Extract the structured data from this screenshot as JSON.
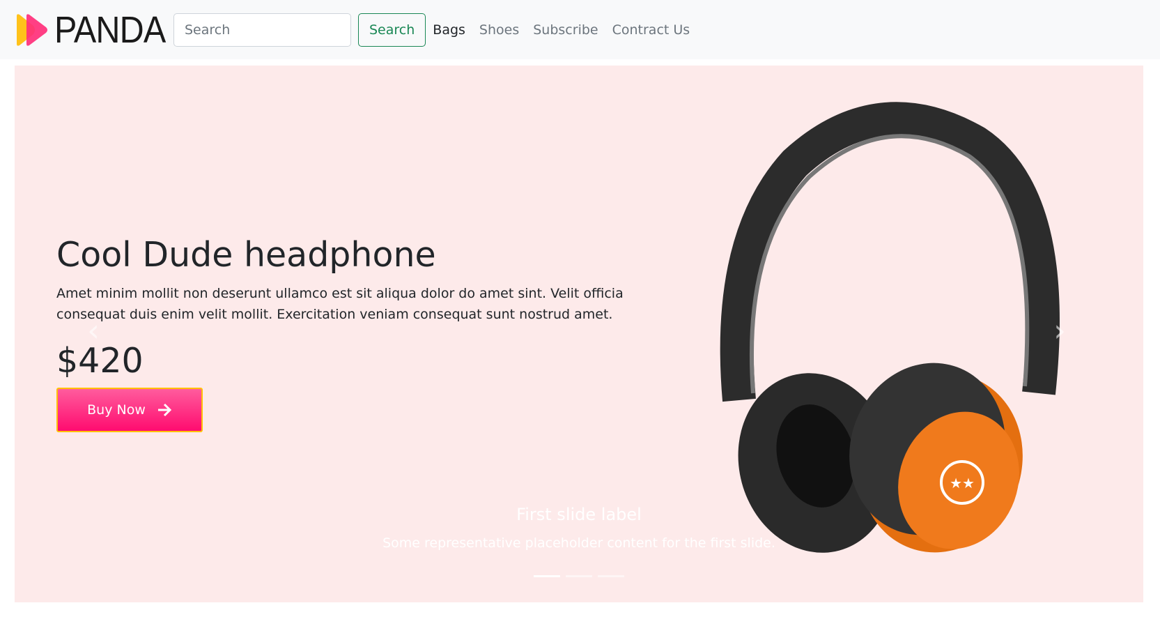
{
  "brand": {
    "name": "PANDA",
    "logo_colors": [
      "#ffc21a",
      "#ff2f7a"
    ]
  },
  "search": {
    "placeholder": "Search",
    "button_label": "Search"
  },
  "nav": {
    "links": [
      {
        "label": "Bags",
        "active": true
      },
      {
        "label": "Shoes"
      },
      {
        "label": "Subscribe"
      },
      {
        "label": "Contract Us"
      }
    ]
  },
  "hero": {
    "title": "Cool Dude headphone",
    "description": "Amet minim mollit non deserunt ullamco est sit aliqua dolor do amet sint. Velit officia consequat duis enim velit mollit. Exercitation veniam consequat sunt nostrud amet.",
    "price": "$420",
    "buy_label": "Buy Now",
    "buy_icon": "arrow-right-icon",
    "accent": "#ff1a75",
    "background": "#fdeaea"
  },
  "carousel": {
    "caption_title": "First slide label",
    "caption_text": "Some representative placeholder content for the first slide.",
    "slides": 3,
    "active_slide": 1,
    "prev_icon": "chevron-left-icon",
    "next_icon": "chevron-right-icon"
  }
}
